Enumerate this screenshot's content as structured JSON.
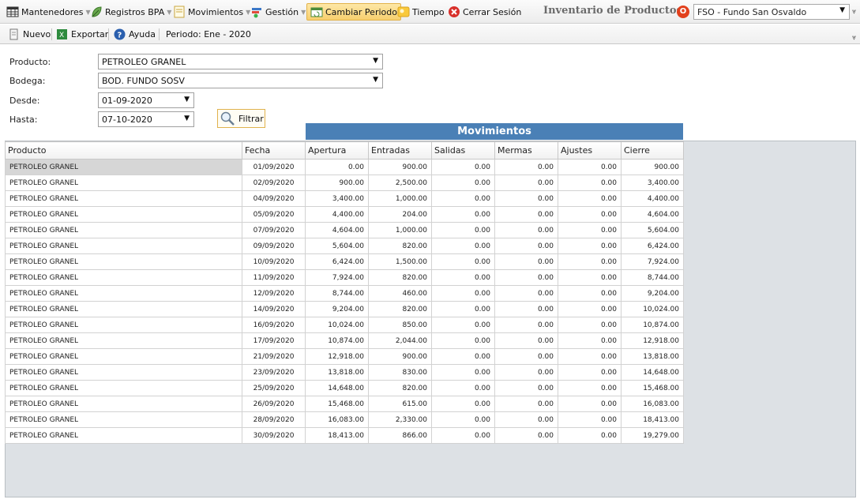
{
  "menu": {
    "mantenedores": "Mantenedores",
    "registros": "Registros BPA",
    "movimientos": "Movimientos",
    "gestion": "Gestión",
    "cambiar_periodo": "Cambiar Periodo",
    "tiempo": "Tiempo",
    "cerrar_sesion": "Cerrar Sesión"
  },
  "app_title": "Inventario de Productos",
  "fundo_selector": {
    "value": "FSO - Fundo San Osvaldo"
  },
  "toolbar": {
    "nuevo": "Nuevo",
    "exportar": "Exportar",
    "ayuda": "Ayuda",
    "periodo": "Periodo: Ene - 2020"
  },
  "filters": {
    "producto_label": "Producto:",
    "producto_value": "PETROLEO GRANEL",
    "bodega_label": "Bodega:",
    "bodega_value": "BOD. FUNDO SOSV",
    "desde_label": "Desde:",
    "desde_value": "01-09-2020",
    "hasta_label": "Hasta:",
    "hasta_value": "07-10-2020",
    "filtrar_label": "Filtrar"
  },
  "grid": {
    "title": "Movimientos",
    "columns": [
      "Producto",
      "Fecha",
      "Apertura",
      "Entradas",
      "Salidas",
      "Mermas",
      "Ajustes",
      "Cierre"
    ],
    "rows": [
      [
        "PETROLEO GRANEL",
        "01/09/2020",
        "0.00",
        "900.00",
        "0.00",
        "0.00",
        "0.00",
        "900.00"
      ],
      [
        "PETROLEO GRANEL",
        "02/09/2020",
        "900.00",
        "2,500.00",
        "0.00",
        "0.00",
        "0.00",
        "3,400.00"
      ],
      [
        "PETROLEO GRANEL",
        "04/09/2020",
        "3,400.00",
        "1,000.00",
        "0.00",
        "0.00",
        "0.00",
        "4,400.00"
      ],
      [
        "PETROLEO GRANEL",
        "05/09/2020",
        "4,400.00",
        "204.00",
        "0.00",
        "0.00",
        "0.00",
        "4,604.00"
      ],
      [
        "PETROLEO GRANEL",
        "07/09/2020",
        "4,604.00",
        "1,000.00",
        "0.00",
        "0.00",
        "0.00",
        "5,604.00"
      ],
      [
        "PETROLEO GRANEL",
        "09/09/2020",
        "5,604.00",
        "820.00",
        "0.00",
        "0.00",
        "0.00",
        "6,424.00"
      ],
      [
        "PETROLEO GRANEL",
        "10/09/2020",
        "6,424.00",
        "1,500.00",
        "0.00",
        "0.00",
        "0.00",
        "7,924.00"
      ],
      [
        "PETROLEO GRANEL",
        "11/09/2020",
        "7,924.00",
        "820.00",
        "0.00",
        "0.00",
        "0.00",
        "8,744.00"
      ],
      [
        "PETROLEO GRANEL",
        "12/09/2020",
        "8,744.00",
        "460.00",
        "0.00",
        "0.00",
        "0.00",
        "9,204.00"
      ],
      [
        "PETROLEO GRANEL",
        "14/09/2020",
        "9,204.00",
        "820.00",
        "0.00",
        "0.00",
        "0.00",
        "10,024.00"
      ],
      [
        "PETROLEO GRANEL",
        "16/09/2020",
        "10,024.00",
        "850.00",
        "0.00",
        "0.00",
        "0.00",
        "10,874.00"
      ],
      [
        "PETROLEO GRANEL",
        "17/09/2020",
        "10,874.00",
        "2,044.00",
        "0.00",
        "0.00",
        "0.00",
        "12,918.00"
      ],
      [
        "PETROLEO GRANEL",
        "21/09/2020",
        "12,918.00",
        "900.00",
        "0.00",
        "0.00",
        "0.00",
        "13,818.00"
      ],
      [
        "PETROLEO GRANEL",
        "23/09/2020",
        "13,818.00",
        "830.00",
        "0.00",
        "0.00",
        "0.00",
        "14,648.00"
      ],
      [
        "PETROLEO GRANEL",
        "25/09/2020",
        "14,648.00",
        "820.00",
        "0.00",
        "0.00",
        "0.00",
        "15,468.00"
      ],
      [
        "PETROLEO GRANEL",
        "26/09/2020",
        "15,468.00",
        "615.00",
        "0.00",
        "0.00",
        "0.00",
        "16,083.00"
      ],
      [
        "PETROLEO GRANEL",
        "28/09/2020",
        "16,083.00",
        "2,330.00",
        "0.00",
        "0.00",
        "0.00",
        "18,413.00"
      ],
      [
        "PETROLEO GRANEL",
        "30/09/2020",
        "18,413.00",
        "866.00",
        "0.00",
        "0.00",
        "0.00",
        "19,279.00"
      ]
    ]
  },
  "colors": {
    "grid_title_bg": "#4a80b6",
    "active_menu_bg": "#f7cf6e",
    "grid_area_bg": "#dde1e5"
  }
}
